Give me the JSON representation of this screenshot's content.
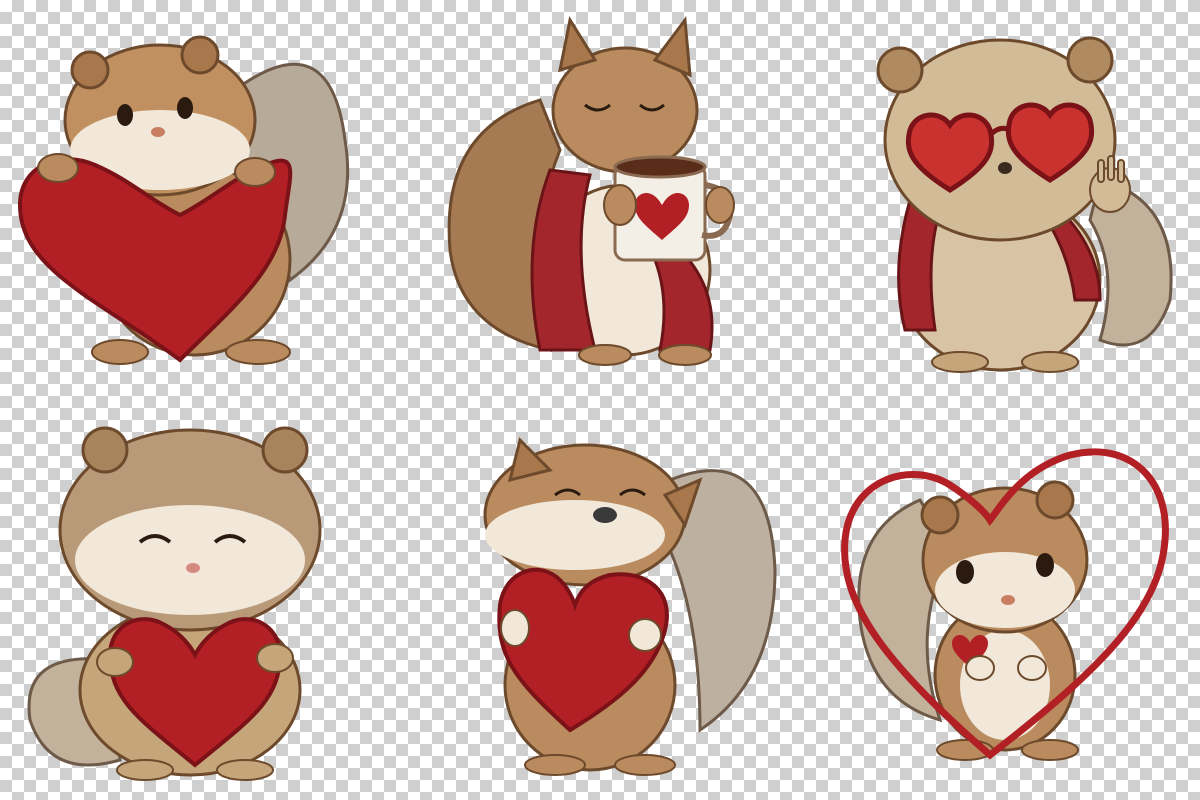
{
  "palette": {
    "fur": "#b98b5e",
    "fur_dark": "#8a5e38",
    "fur_light": "#f1e8d9",
    "heart_red": "#b21f25",
    "sweater_red": "#a2262b",
    "mug": "#f4efe6",
    "coffee": "#5a2c1a",
    "ink": "#2b1a10",
    "checker_light": "#ffffff",
    "checker_dark": "#cfcfcf"
  },
  "stickers": [
    {
      "id": "hugging-heart-top",
      "props": [
        "heart-icon"
      ]
    },
    {
      "id": "coffee-mug",
      "props": [
        "mug-icon",
        "heart-icon"
      ]
    },
    {
      "id": "heart-sunglasses-waving",
      "props": [
        "heart-glasses-icon",
        "sweater"
      ]
    },
    {
      "id": "smiling-heart",
      "props": [
        "heart-icon"
      ]
    },
    {
      "id": "cuddling-heart",
      "props": [
        "heart-icon"
      ]
    },
    {
      "id": "heart-frame",
      "props": [
        "heart-outline-icon"
      ]
    }
  ]
}
